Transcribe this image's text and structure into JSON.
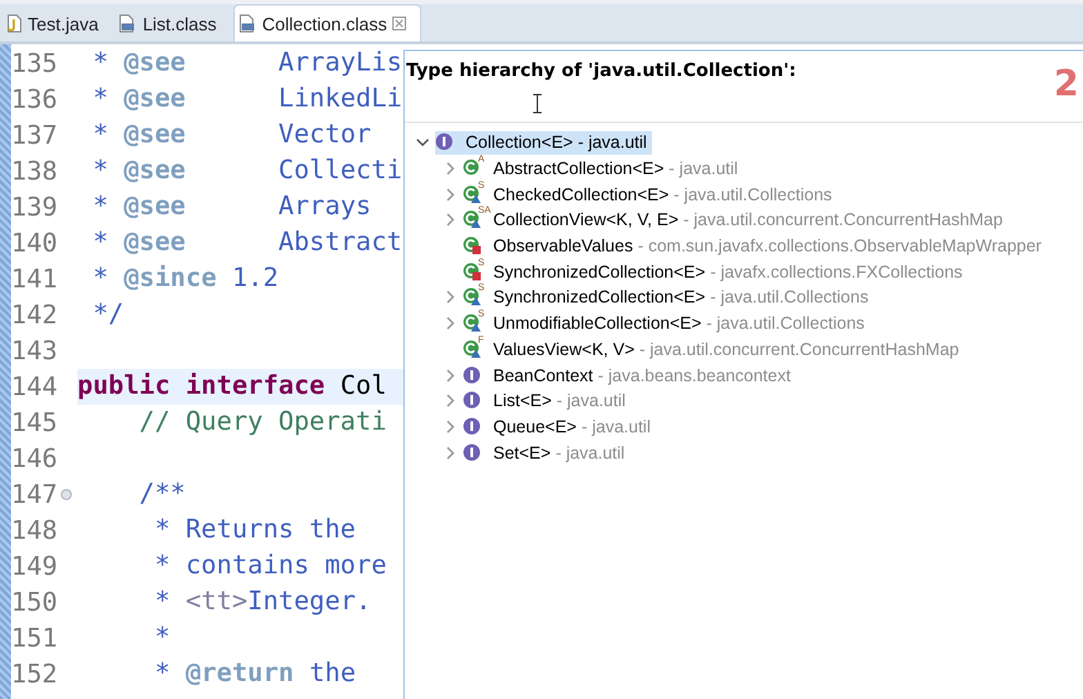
{
  "tabs": [
    {
      "label": "Test.java",
      "kind": "source",
      "selected": false,
      "closable": false
    },
    {
      "label": "List.class",
      "kind": "binary",
      "selected": false,
      "closable": false
    },
    {
      "label": "Collection.class",
      "kind": "binary",
      "selected": true,
      "closable": true
    }
  ],
  "editor": {
    "lines": [
      {
        "number": "135",
        "tokens": [
          {
            "kind": "doc",
            "text": " * "
          },
          {
            "kind": "tag",
            "text": "@see"
          },
          {
            "kind": "doc",
            "text": "      ArrayLis"
          }
        ]
      },
      {
        "number": "136",
        "tokens": [
          {
            "kind": "doc",
            "text": " * "
          },
          {
            "kind": "tag",
            "text": "@see"
          },
          {
            "kind": "doc",
            "text": "      LinkedLi"
          }
        ]
      },
      {
        "number": "137",
        "tokens": [
          {
            "kind": "doc",
            "text": " * "
          },
          {
            "kind": "tag",
            "text": "@see"
          },
          {
            "kind": "doc",
            "text": "      Vector"
          }
        ]
      },
      {
        "number": "138",
        "tokens": [
          {
            "kind": "doc",
            "text": " * "
          },
          {
            "kind": "tag",
            "text": "@see"
          },
          {
            "kind": "doc",
            "text": "      Collecti"
          }
        ]
      },
      {
        "number": "139",
        "tokens": [
          {
            "kind": "doc",
            "text": " * "
          },
          {
            "kind": "tag",
            "text": "@see"
          },
          {
            "kind": "doc",
            "text": "      Arrays"
          }
        ]
      },
      {
        "number": "140",
        "tokens": [
          {
            "kind": "doc",
            "text": " * "
          },
          {
            "kind": "tag",
            "text": "@see"
          },
          {
            "kind": "doc",
            "text": "      Abstract"
          }
        ]
      },
      {
        "number": "141",
        "tokens": [
          {
            "kind": "doc",
            "text": " * "
          },
          {
            "kind": "tag",
            "text": "@since"
          },
          {
            "kind": "doc",
            "text": " 1.2"
          }
        ]
      },
      {
        "number": "142",
        "tokens": [
          {
            "kind": "doc",
            "text": " */"
          }
        ]
      },
      {
        "number": "143"
      },
      {
        "number": "144",
        "current": true,
        "tokens": [
          {
            "kind": "keyword",
            "text": "public"
          },
          {
            "kind": "keyword",
            "text": " interface"
          },
          {
            "kind": "plain",
            "text": " Col"
          }
        ]
      },
      {
        "number": "145",
        "tokens": [
          {
            "kind": "comment",
            "text": "    // Query Operati"
          }
        ]
      },
      {
        "number": "146"
      },
      {
        "number": "147",
        "folding": true,
        "tokens": [
          {
            "kind": "doc",
            "text": "    /**"
          }
        ]
      },
      {
        "number": "148",
        "tokens": [
          {
            "kind": "doc",
            "text": "     * Returns the"
          }
        ]
      },
      {
        "number": "149",
        "tokens": [
          {
            "kind": "doc",
            "text": "     * contains more"
          }
        ]
      },
      {
        "number": "150",
        "tokens": [
          {
            "kind": "doc",
            "text": "     * "
          },
          {
            "kind": "html",
            "text": "<tt>"
          },
          {
            "kind": "doc",
            "text": "Integer."
          }
        ]
      },
      {
        "number": "151",
        "tokens": [
          {
            "kind": "doc",
            "text": "     *"
          }
        ]
      },
      {
        "number": "152",
        "tokens": [
          {
            "kind": "doc",
            "text": "     * "
          },
          {
            "kind": "tag",
            "text": "@return"
          },
          {
            "kind": "doc",
            "text": " the"
          }
        ]
      }
    ]
  },
  "hierarchy_popup": {
    "title": "Type hierarchy of 'java.util.Collection':",
    "annotation": "2",
    "root": {
      "name": "Collection<E>",
      "package": "- java.util",
      "kind": "interface",
      "expanded": true,
      "selected": true,
      "children": [
        {
          "name": "AbstractCollection<E>",
          "package": "- java.util",
          "kind": "class",
          "modifiers": "A",
          "expandable": true,
          "selected": false
        },
        {
          "name": "CheckedCollection<E>",
          "package": "- java.util.Collections",
          "kind": "packageclass",
          "modifiers": "S",
          "expandable": true,
          "selected": false
        },
        {
          "name": "CollectionView<K, V, E>",
          "package": "- java.util.concurrent.ConcurrentHashMap",
          "kind": "packageclass",
          "modifiers": "SA",
          "expandable": true,
          "selected": false
        },
        {
          "name": "ObservableValues",
          "package": "- com.sun.javafx.collections.ObservableMapWrapper",
          "kind": "privateclass",
          "expandable": false,
          "selected": false
        },
        {
          "name": "SynchronizedCollection<E>",
          "package": "- javafx.collections.FXCollections",
          "kind": "privateclass",
          "modifiers": "S",
          "expandable": false,
          "selected": false
        },
        {
          "name": "SynchronizedCollection<E>",
          "package": "- java.util.Collections",
          "kind": "packageclass",
          "modifiers": "S",
          "expandable": true,
          "selected": false
        },
        {
          "name": "UnmodifiableCollection<E>",
          "package": "- java.util.Collections",
          "kind": "packageclass",
          "modifiers": "S",
          "expandable": true,
          "selected": false
        },
        {
          "name": "ValuesView<K, V>",
          "package": "- java.util.concurrent.ConcurrentHashMap",
          "kind": "packageclass",
          "modifiers": "F",
          "expandable": false,
          "selected": false
        },
        {
          "name": "BeanContext",
          "package": "- java.beans.beancontext",
          "kind": "interface",
          "expandable": true,
          "selected": false
        },
        {
          "name": "List<E>",
          "package": "- java.util",
          "kind": "interface",
          "expandable": true,
          "selected": false
        },
        {
          "name": "Queue<E>",
          "package": "- java.util",
          "kind": "interface",
          "expandable": true,
          "selected": false
        },
        {
          "name": "Set<E>",
          "package": "- java.util",
          "kind": "interface",
          "expandable": true,
          "selected": false
        }
      ]
    }
  }
}
